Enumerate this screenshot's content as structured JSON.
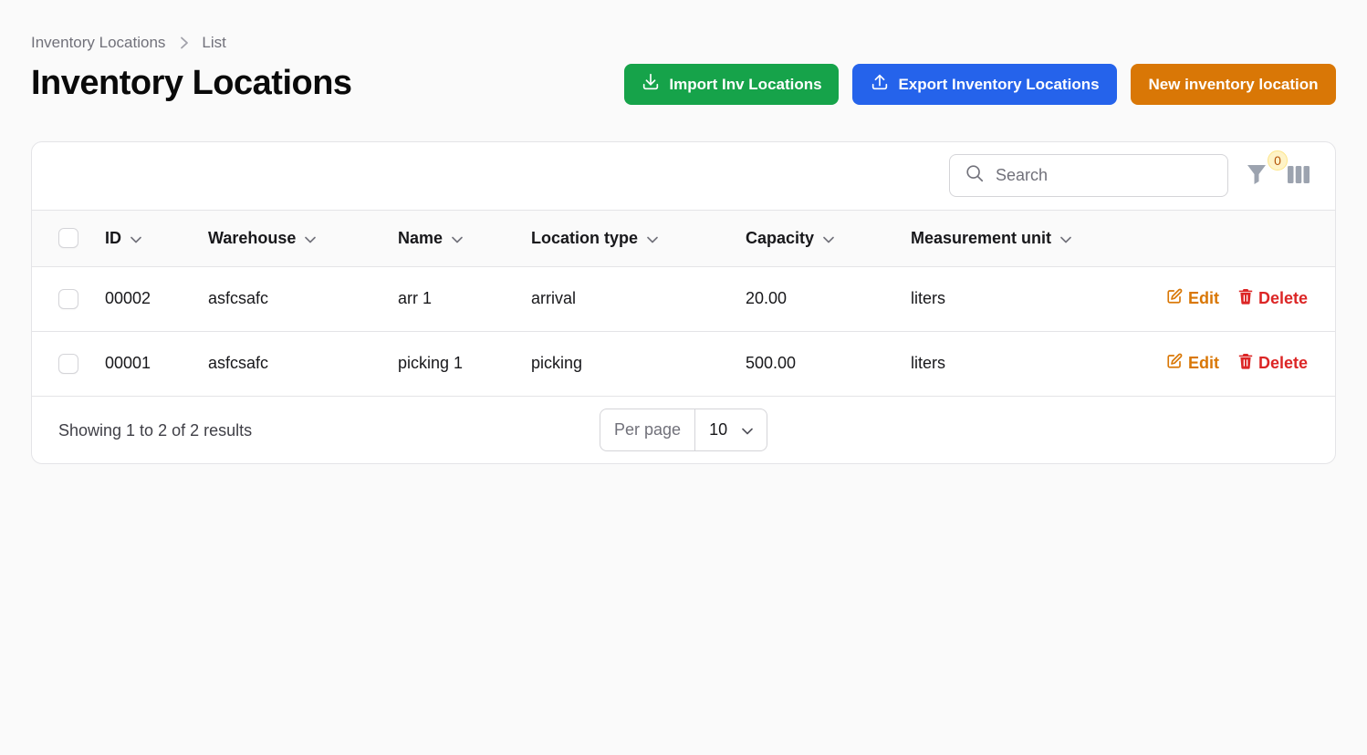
{
  "breadcrumb": {
    "parent": "Inventory Locations",
    "current": "List"
  },
  "page": {
    "title": "Inventory Locations"
  },
  "actions": {
    "import_label": "Import Inv Locations",
    "export_label": "Export Inventory Locations",
    "new_label": "New inventory location"
  },
  "colors": {
    "import": "#16a34a",
    "export": "#2563eb",
    "new": "#d97706",
    "edit": "#d97706",
    "delete": "#dc2626"
  },
  "toolbar": {
    "search_placeholder": "Search",
    "filter_count": "0"
  },
  "table": {
    "columns": [
      "ID",
      "Warehouse",
      "Name",
      "Location type",
      "Capacity",
      "Measurement unit"
    ],
    "rows": [
      {
        "id": "00002",
        "warehouse": "asfcsafc",
        "name": "arr 1",
        "location_type": "arrival",
        "capacity": "20.00",
        "unit": "liters"
      },
      {
        "id": "00001",
        "warehouse": "asfcsafc",
        "name": "picking 1",
        "location_type": "picking",
        "capacity": "500.00",
        "unit": "liters"
      }
    ],
    "edit_label": "Edit",
    "delete_label": "Delete"
  },
  "pagination": {
    "summary": "Showing 1 to 2 of 2 results",
    "per_page_label": "Per page",
    "per_page_value": "10"
  }
}
